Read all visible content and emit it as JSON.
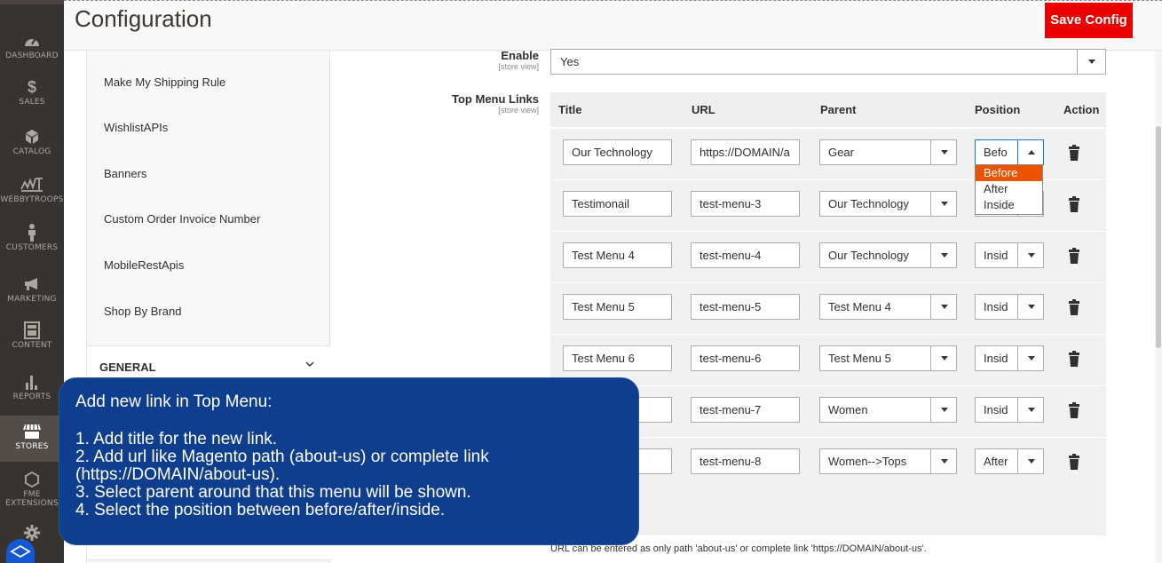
{
  "nav": {
    "items": [
      {
        "label": "DASHBOARD",
        "icon": "dashboard-icon"
      },
      {
        "label": "SALES",
        "icon": "dollar-icon"
      },
      {
        "label": "CATALOG",
        "icon": "cube-icon"
      },
      {
        "label": "WEBBYTROOPS",
        "icon": "webbytroops-icon"
      },
      {
        "label": "CUSTOMERS",
        "icon": "person-icon"
      },
      {
        "label": "MARKETING",
        "icon": "megaphone-icon"
      },
      {
        "label": "CONTENT",
        "icon": "layout-icon"
      },
      {
        "label": "REPORTS",
        "icon": "bar-chart-icon"
      },
      {
        "label": "STORES",
        "icon": "storefront-icon"
      },
      {
        "label": "FME",
        "icon": "hexagon-icon"
      },
      {
        "label": "EXTENSIONS",
        "icon": "hexagon-icon"
      }
    ]
  },
  "header": {
    "title": "Configuration",
    "save_label": "Save Config"
  },
  "tabs": {
    "items": [
      "Make My Shipping Rule",
      "WishlistAPIs",
      "Banners",
      "Custom Order Invoice Number",
      "MobileRestApis",
      "Shop By Brand"
    ],
    "general_label": "GENERAL"
  },
  "enable": {
    "label": "Enable",
    "scope": "[store view]",
    "value": "Yes"
  },
  "top_menu": {
    "label": "Top Menu Links",
    "scope": "[store view]",
    "columns": [
      "Title",
      "URL",
      "Parent",
      "Position",
      "Action"
    ],
    "rows": [
      {
        "title": "Our Technology",
        "url": "https://DOMAIN/a",
        "parent": "Gear",
        "position": "Befo"
      },
      {
        "title": "Testimonail",
        "url": "test-menu-3",
        "parent": "Our Technology",
        "position": ""
      },
      {
        "title": "Test Menu 4",
        "url": "test-menu-4",
        "parent": "Our Technology",
        "position": "Insid"
      },
      {
        "title": "Test Menu 5",
        "url": "test-menu-5",
        "parent": "Test Menu 4",
        "position": "Insid"
      },
      {
        "title": "Test Menu 6",
        "url": "test-menu-6",
        "parent": "Test Menu 5",
        "position": "Insid"
      },
      {
        "title": "",
        "url": "test-menu-7",
        "parent": "Women",
        "position": "Insid"
      },
      {
        "title": "",
        "url": "test-menu-8",
        "parent": "Women-->Tops",
        "position": "After"
      }
    ],
    "position_options": [
      "Before",
      "After",
      "Inside"
    ],
    "hint": "URL can be entered as only path 'about-us' or complete link 'https://DOMAIN/about-us'."
  },
  "tooltip": {
    "title": "Add new link in Top Menu:",
    "steps": [
      "1. Add title for the new link.",
      "2. Add url like Magento path (about-us) or complete link",
      "(https://DOMAIN/about-us).",
      "3. Select parent around that this menu will be shown.",
      "4. Select the position between before/after/inside."
    ]
  },
  "colors": {
    "nav_bg": "#373330",
    "save_bg": "#eb0000",
    "tooltip_bg": "#0f3e8f",
    "highlight": "#eb5202"
  }
}
